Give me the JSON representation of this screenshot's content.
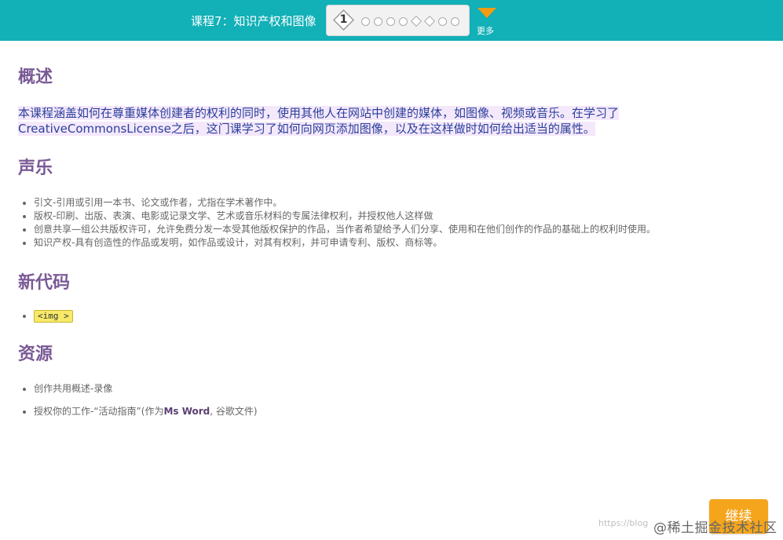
{
  "header": {
    "title": "课程7：知识产权和图像",
    "current_step": "1",
    "more_label": "更多"
  },
  "sections": {
    "overview": {
      "heading": "概述",
      "line1": "本课程涵盖如何在尊重媒体创建者的权利的同时，使用其他人在网站中创建的媒体，如图像、视频或音乐。在学习了",
      "line2": "CreativeCommonsLicense之后，这门课学习了如何向网页添加图像，以及在这样做时如何给出适当的属性。"
    },
    "vocab": {
      "heading": "声乐",
      "items": [
        "引文-引用或引用一本书、论文或作者，尤指在学术著作中。",
        "版权-印刷、出版、表演、电影或记录文学、艺术或音乐材料的专属法律权利，并授权他人这样做",
        "创意共享—组公共版权许可，允许免费分发一本受其他版权保护的作品，当作者希望给予人们分享、使用和在他们创作的作品的基础上的权利时使用。",
        "知识产权-具有创造性的作品或发明，如作品或设计，对其有权利，并可申请专利、版权、商标等。"
      ]
    },
    "new_code": {
      "heading": "新代码",
      "code": "<img >"
    },
    "resources": {
      "heading": "资源",
      "item1": "创作共用概述-录像",
      "item2_prefix": "授权你的工作-“活动指南”(作为",
      "item2_bold": "Ms Word",
      "item2_suffix": ", 谷歌文件)"
    }
  },
  "footer": {
    "continue_label": "继续",
    "watermark_url": "https://blog",
    "watermark_site": "@稀土掘金技术社区"
  }
}
